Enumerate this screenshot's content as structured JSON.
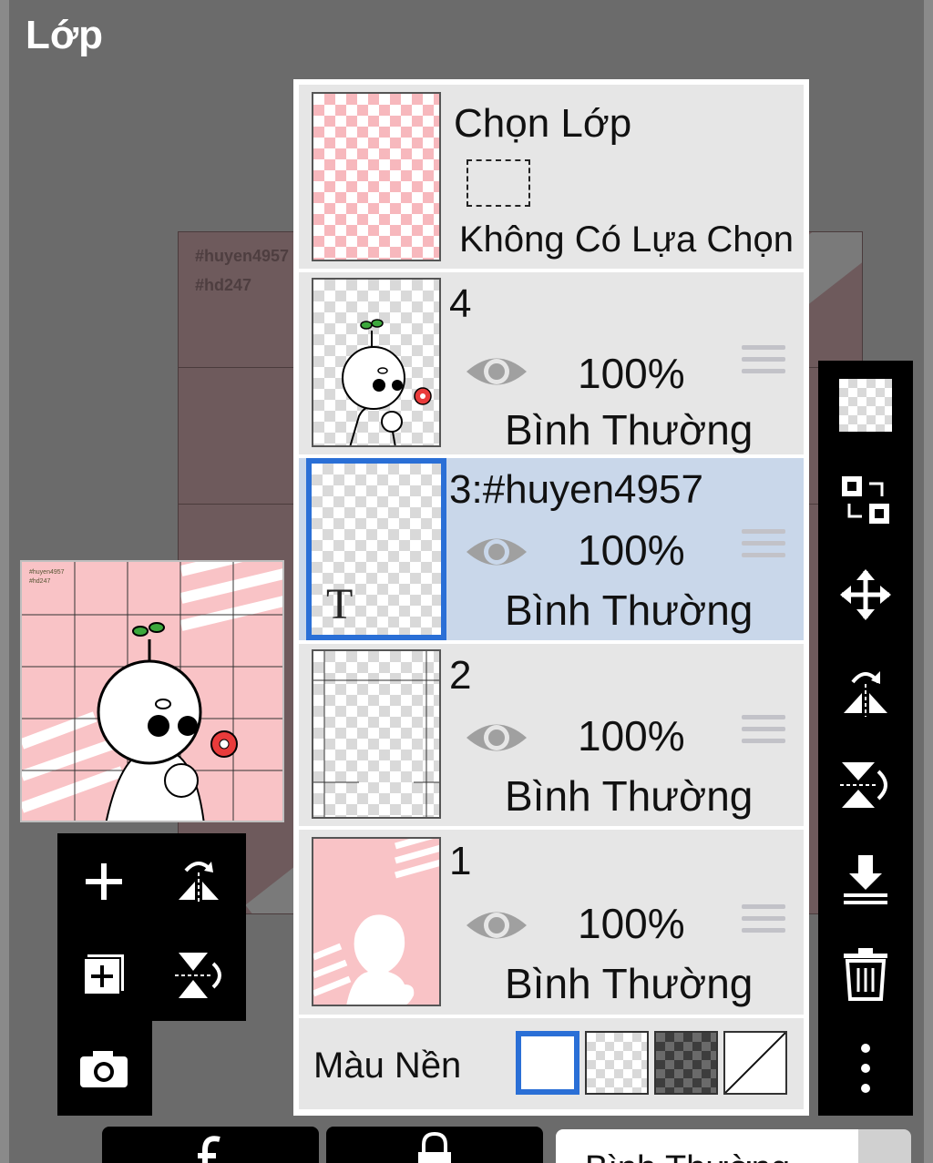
{
  "window": {
    "title": "Lớp"
  },
  "canvas": {
    "tags": [
      "#huyen4957",
      "#hd247"
    ]
  },
  "selection": {
    "title": "Chọn Lớp",
    "status": "Không Có Lựa Chọn"
  },
  "layers": [
    {
      "name": "4",
      "opacity": "100%",
      "blend": "Bình Thường",
      "visible": true,
      "selected": false
    },
    {
      "name": "3:#huyen4957",
      "opacity": "100%",
      "blend": "Bình Thường",
      "visible": true,
      "selected": true,
      "type_glyph": "T"
    },
    {
      "name": "2",
      "opacity": "100%",
      "blend": "Bình Thường",
      "visible": true,
      "selected": false
    },
    {
      "name": "1",
      "opacity": "100%",
      "blend": "Bình Thường",
      "visible": true,
      "selected": false
    }
  ],
  "background": {
    "label": "Màu Nền",
    "options": [
      "white",
      "transparent-light",
      "transparent-dark",
      "none"
    ],
    "selected": "white"
  },
  "left_toolbar": [
    "add-layer-icon",
    "flip-horizontal-icon",
    "duplicate-layer-icon",
    "flip-vertical-icon",
    "camera-icon"
  ],
  "right_toolbar": [
    "transparency-icon",
    "swap-icon",
    "move-icon",
    "flip-horizontal-icon",
    "flip-vertical-icon",
    "merge-down-icon",
    "trash-icon",
    "more-icon"
  ],
  "bottom_bar": {
    "blend_mode": "Bình Thường"
  },
  "colors": {
    "accent": "#2a6fd6",
    "selected_row": "#c9d7ea",
    "pink": "#f9c3c6"
  }
}
